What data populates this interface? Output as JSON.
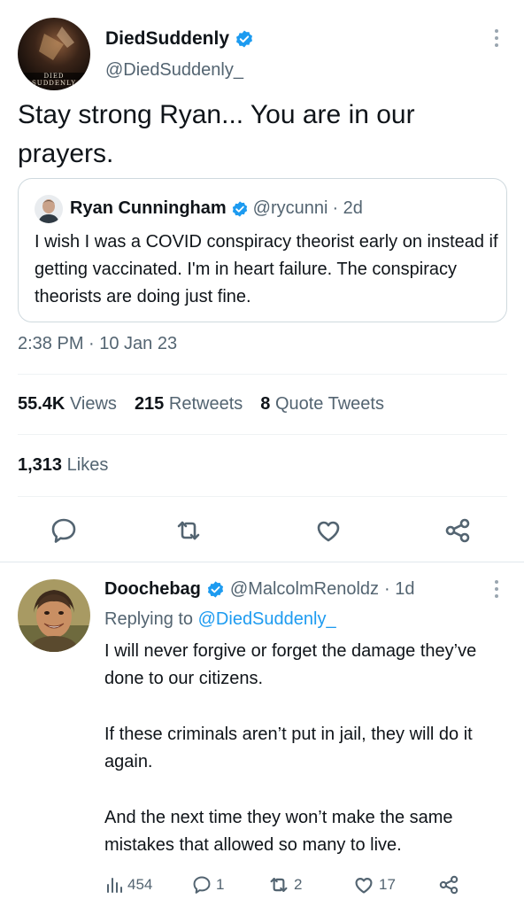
{
  "tweet": {
    "author_name": "DiedSuddenly",
    "author_handle": "@DiedSuddenly_",
    "avatar_caption": "DIED SUDDENLY",
    "text": "Stay strong Ryan... You are in our prayers.",
    "timestamp": "2:38 PM · 10 Jan 23",
    "stats": {
      "views_count": "55.4K",
      "views_label": "Views",
      "retweets_count": "215",
      "retweets_label": "Retweets",
      "quotes_count": "8",
      "quotes_label": "Quote Tweets",
      "likes_count": "1,313",
      "likes_label": "Likes"
    }
  },
  "quoted": {
    "name": "Ryan Cunningham",
    "handle": "@rycunni",
    "age": "· 2d",
    "text": "I wish I was a COVID conspiracy theorist early on instead if getting vaccinated.  I'm in heart failure. The conspiracy theorists are doing just fine."
  },
  "reply": {
    "name": "Doochebag",
    "handle": "@MalcolmRenoldz",
    "age": "· 1d",
    "replying_prefix": "Replying to",
    "replying_to": "@DiedSuddenly_",
    "paragraphs": [
      "I will never forgive or forget the damage they’ve done to our citizens.",
      "If these criminals aren’t put in jail, they will do it again.",
      "And the next time they won’t make the same mistakes that allowed so many to live."
    ],
    "counts": {
      "views": "454",
      "replies": "1",
      "retweets": "2",
      "likes": "17"
    }
  },
  "colors": {
    "verified": "#1d9bf0",
    "secondary_text": "#536471",
    "border": "#cfd9de"
  },
  "icons": [
    "verified-badge-icon",
    "more-icon",
    "reply-icon",
    "retweet-icon",
    "like-icon",
    "share-icon",
    "views-icon"
  ]
}
